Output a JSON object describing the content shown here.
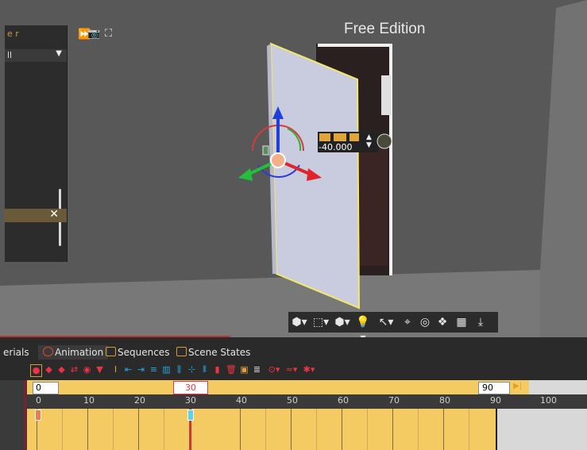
{
  "viewport": {
    "watermark": "Free Edition",
    "left_panel": {
      "search_text": "e r",
      "filter_value": "ll",
      "filter_arrow": "▼"
    },
    "top_tools": [
      "⏩",
      "📷",
      "⛶"
    ],
    "gizmo_value": "-40.000",
    "bottom_tools": [
      "⬢▾",
      "⬚▾",
      "⬢▾",
      "💡▾",
      "↖▾",
      "⌖",
      "◎",
      "❖",
      "▦",
      "⤓"
    ]
  },
  "tabs": [
    {
      "label": "erials"
    },
    {
      "label": "Animation"
    },
    {
      "label": "Sequences"
    },
    {
      "label": "Scene States"
    }
  ],
  "timeline": {
    "start_frame": "0",
    "current_frame": "30",
    "end_frame": "90",
    "ruler_labels": [
      "0",
      "10",
      "20",
      "30",
      "40",
      "50",
      "60",
      "70",
      "80",
      "90",
      "100"
    ]
  },
  "colors": {
    "accent": "#f4ca63",
    "playhead": "#e22233",
    "panel": "#2a2a2a"
  }
}
